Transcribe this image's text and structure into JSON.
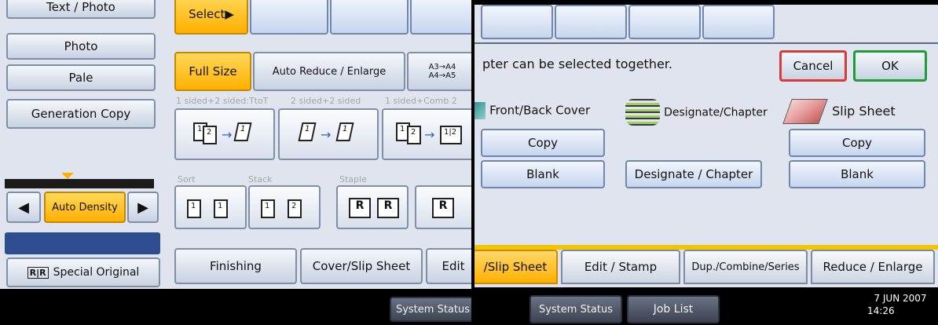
{
  "left": {
    "text_photo_label": "Text / Photo",
    "photo_label": "Photo",
    "pale_label": "Pale",
    "generation_copy_label": "Generation Copy",
    "select_label": "Select▶",
    "full_size_label": "Full Size",
    "auto_reduce_label": "Auto Reduce / Enlarge",
    "paper_sizes_label": "A3→A4\nA4→A5",
    "duplex_hints": [
      "1 sided+2 sided:TtoT",
      "2 sided+2 sided",
      "1 sided+Comb 2"
    ],
    "sort_label": "Sort",
    "stack_label": "Stack",
    "staple_label": "Staple",
    "auto_density_label": "Auto Density",
    "special_original_label": "Special Original",
    "finishing_label": "Finishing",
    "cover_slip_label": "Cover/Slip Sheet",
    "edit_label": "Edit",
    "system_status_label": "System Status"
  },
  "right": {
    "instruction": "pter can be selected together.",
    "cancel_label": "Cancel",
    "ok_label": "OK",
    "front_back_cover_label": "Front/Back Cover",
    "designate_chapter_label": "Designate/Chapter",
    "slip_sheet_label": "Slip Sheet",
    "copy_label_left": "Copy",
    "copy_label_right": "Copy",
    "blank_label_left": "Blank",
    "blank_label_right": "Blank",
    "designate_chapter_button": "Designate / Chapter",
    "tabs": {
      "slip_sheet": "/Slip Sheet",
      "edit_stamp": "Edit / Stamp",
      "dup_combine": "Dup./Combine/Series",
      "reduce_enlarge": "Reduce / Enlarge"
    },
    "system_status_label": "System Status",
    "job_list_label": "Job List",
    "date": "7 JUN  2007",
    "time": "14:26"
  },
  "colors": {
    "accent_orange": "#ffb000",
    "ok_green": "#1e9c3a",
    "cancel_red": "#d83a3a",
    "tab_active": "#ffb100"
  }
}
